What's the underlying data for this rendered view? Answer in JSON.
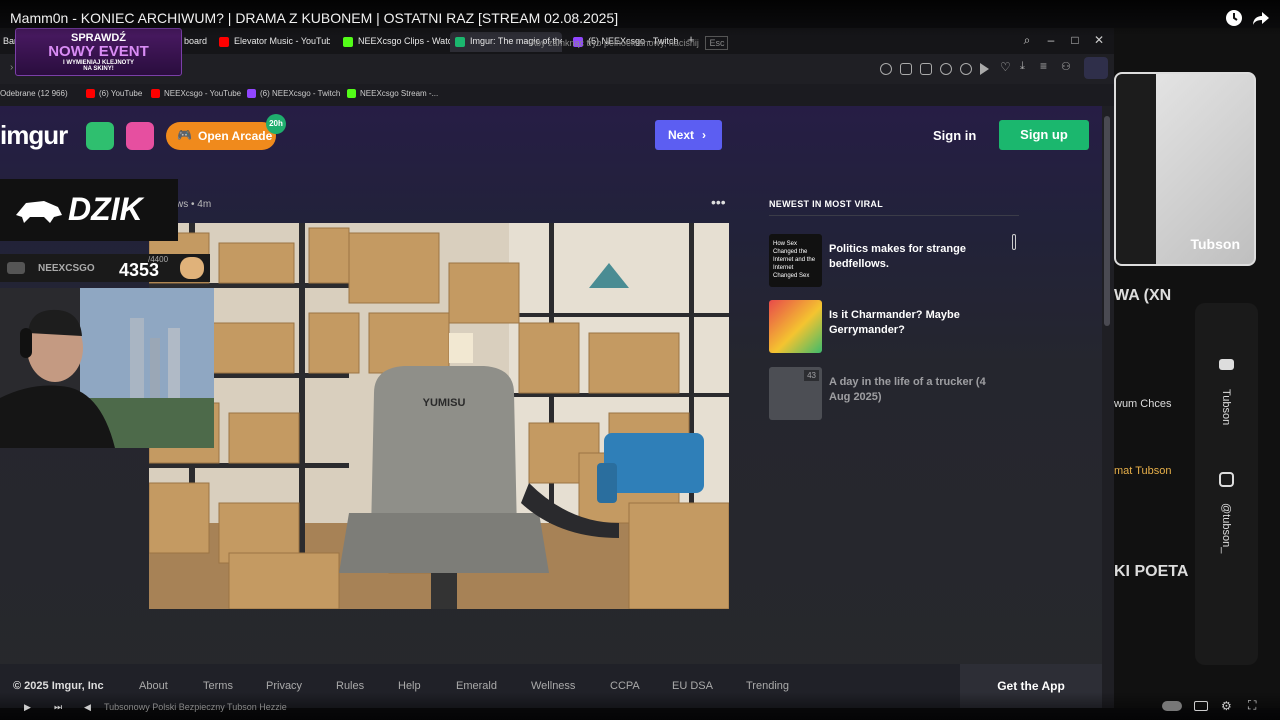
{
  "video": {
    "title": "Mamm0n - KONIEC ARCHIWUM? | DRAMA Z KUBONEM | OSTATNI RAZ [STREAM 02.08.2025]"
  },
  "browser": {
    "tabs": [
      {
        "label": "Ban",
        "color": "#888888"
      },
      {
        "label": "board",
        "color": "#888888"
      },
      {
        "label": "Elevator Music - YouTube",
        "color": "#ff0000"
      },
      {
        "label": "NEEXcsgo Clips - Watch L",
        "color": "#53fc18"
      },
      {
        "label": "Imgur: The magic of the I",
        "color": "#1bb76e"
      },
      {
        "label": "(5) NEEXcsgo - Twitch",
        "color": "#9146ff"
      }
    ],
    "fullscreen_hint": "Aby zamknąć tryb pełnoekranowy, naciśnij",
    "fullscreen_key": "Esc",
    "bookmarks": [
      {
        "label": "Odebrane (12 966)",
        "color": "#c4302b"
      },
      {
        "label": "(6) YouTube",
        "color": "#ff0000"
      },
      {
        "label": "NEEXcsgo - YouTube",
        "color": "#ff0000"
      },
      {
        "label": "(6) NEEXcsgo - Twitch",
        "color": "#9146ff"
      },
      {
        "label": "NEEXcsgo Stream -...",
        "color": "#53fc18"
      }
    ]
  },
  "imgur": {
    "logo": "imgur",
    "arcade_label": "Open Arcade",
    "arcade_badge": "20h",
    "next_label": "Next",
    "signin_label": "Sign in",
    "signup_label": "Sign up",
    "post_meta": "ws • 4m",
    "sidebar_heading": "NEWEST IN MOST VIRAL",
    "viral": [
      {
        "title": "Politics makes for strange bedfellows.",
        "thumb_text": "How Sex Changed the Internet and the Internet Changed Sex"
      },
      {
        "title": "Is it Charmander? Maybe Gerrymander?",
        "thumb_text": ""
      },
      {
        "title": "A day in the life of a trucker (4 Aug 2025)",
        "thumb_text": "43"
      }
    ],
    "image_chair_brand": "YUMISU",
    "footer": {
      "links": [
        "© 2025 Imgur, Inc",
        "About",
        "Terms",
        "Privacy",
        "Rules",
        "Help",
        "Emerald",
        "Wellness",
        "CCPA",
        "EU DSA",
        "Trending"
      ],
      "get_app": "Get the App"
    }
  },
  "overlays": {
    "event_line1": "SPRAWDŹ",
    "event_line2": "NOWY EVENT",
    "event_line3": "I WYMIENIAJ KLEJNOTY",
    "event_line4": "NA SKINY!",
    "dzik": "DZIK",
    "neex_name": "NEEXCSGO",
    "neex_count": "4353",
    "neex_goal": "/4400"
  },
  "right_panel": {
    "cam_label": "Tubson",
    "text1": "WA (XN",
    "text2": "wum Chces",
    "text3": "mat Tubson",
    "text4": "KI POETA",
    "social1": "Tubson",
    "social2": "@tubson_"
  },
  "player": {
    "subtitle": "Tubsonowy Polski Bezpieczny Tubson Hezzie"
  }
}
